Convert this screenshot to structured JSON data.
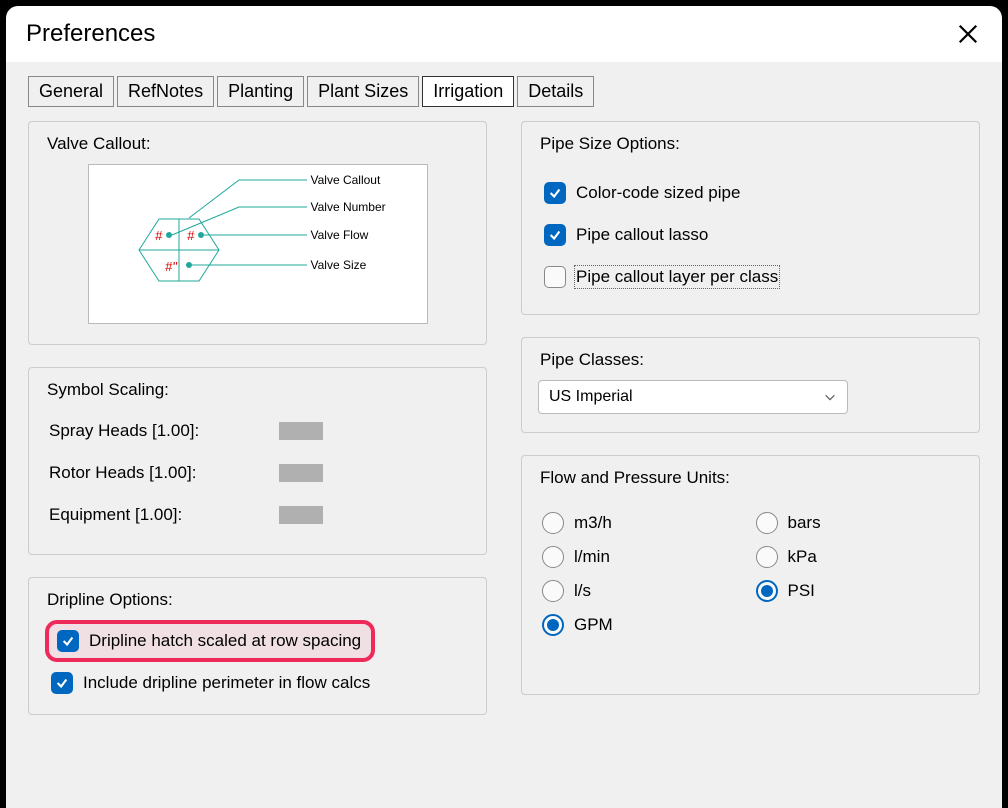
{
  "title": "Preferences",
  "tabs": [
    "General",
    "RefNotes",
    "Planting",
    "Plant Sizes",
    "Irrigation",
    "Details"
  ],
  "active_tab_index": 4,
  "valve_callout": {
    "legend": "Valve Callout:",
    "labels": {
      "callout": "Valve Callout",
      "number": "Valve Number",
      "flow": "Valve Flow",
      "size": "Valve Size"
    },
    "glyphs": {
      "num": "#",
      "flow": "#",
      "size": "#\""
    }
  },
  "symbol_scaling": {
    "legend": "Symbol Scaling:",
    "rows": [
      {
        "label": "Spray Heads [1.00]:"
      },
      {
        "label": "Rotor Heads [1.00]:"
      },
      {
        "label": "Equipment [1.00]:"
      }
    ]
  },
  "dripline": {
    "legend": "Dripline Options:",
    "hatch": {
      "label": "Dripline hatch scaled at row spacing",
      "checked": true,
      "highlight": true
    },
    "perimeter": {
      "label": "Include dripline perimeter in flow calcs",
      "checked": true
    }
  },
  "pipe_size": {
    "legend": "Pipe Size Options:",
    "color_code": {
      "label": "Color-code sized pipe",
      "checked": true
    },
    "lasso": {
      "label": "Pipe callout lasso",
      "checked": true
    },
    "layer_per_class": {
      "label": "Pipe callout layer per class",
      "checked": false
    }
  },
  "pipe_classes": {
    "legend": "Pipe Classes:",
    "value": "US Imperial"
  },
  "flow_pressure": {
    "legend": "Flow and Pressure Units:",
    "flow": {
      "options": [
        "m3/h",
        "l/min",
        "l/s",
        "GPM"
      ],
      "selected": "GPM"
    },
    "pressure": {
      "options": [
        "bars",
        "kPa",
        "PSI"
      ],
      "selected": "PSI"
    }
  }
}
